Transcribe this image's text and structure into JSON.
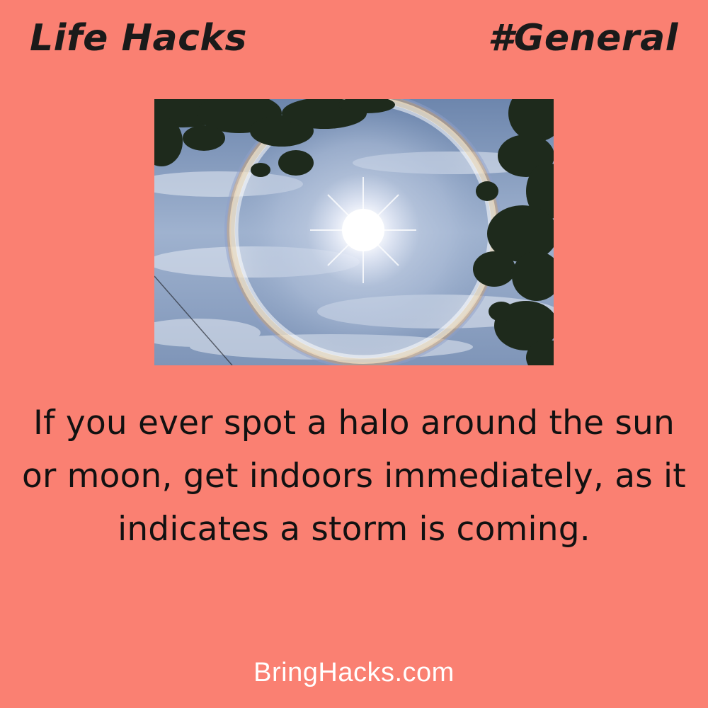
{
  "header": {
    "title": "Life Hacks",
    "category": "#General"
  },
  "photo": {
    "icon": "sun-halo-photo"
  },
  "caption": {
    "text": "If you ever spot a halo around the sun or moon, get indoors immediately, as it indicates a storm is coming."
  },
  "footer": {
    "site": "BringHacks.com"
  },
  "colors": {
    "background": "#FA8072",
    "header_text": "#1a1a1a",
    "caption_text": "#111111",
    "footer_text": "#ffffff"
  }
}
